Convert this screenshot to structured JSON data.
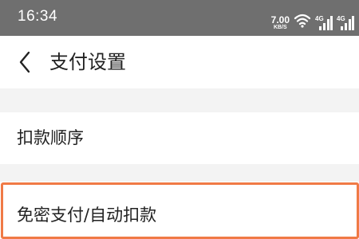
{
  "status_bar": {
    "time": "16:34",
    "net_speed_value": "7.00",
    "net_speed_unit": "KB/S",
    "signal_1_label": "4G",
    "signal_2_label": "4G",
    "icons": [
      "wifi-icon",
      "signal-icon",
      "signal-icon"
    ]
  },
  "header": {
    "back_icon": "chevron-left-icon",
    "title": "支付设置"
  },
  "settings": {
    "items": [
      {
        "label": "扣款顺序"
      },
      {
        "label": "免密支付/自动扣款",
        "highlight_color": "#f07a46"
      }
    ]
  },
  "colors": {
    "status_bar_bg": "#6f6f6f",
    "section_gap_bg": "#f3f3f3",
    "highlight": "#f07a46",
    "text": "#222222"
  }
}
